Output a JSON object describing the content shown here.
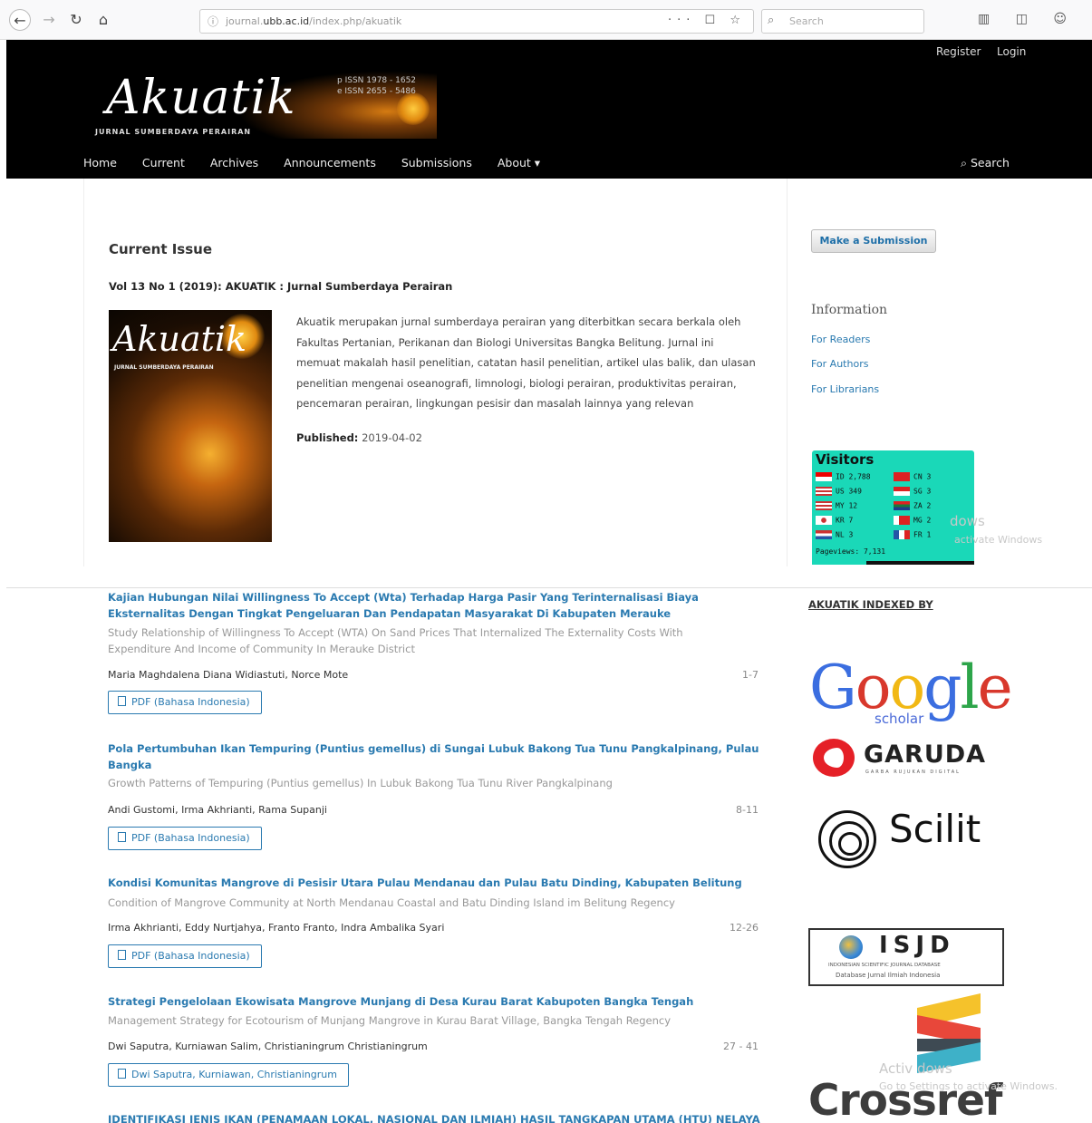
{
  "browser": {
    "back_icon": "back-arrow-icon",
    "url_prefix": "journal.",
    "url_domain": "ubb.ac.id",
    "url_path": "/index.php/akuatik",
    "url_actions": "··· ☐ ☆",
    "search_placeholder": "Search",
    "toolbar_icons": "▥ ◫ ☺"
  },
  "header": {
    "register_label": "Register",
    "login_label": "Login",
    "logo_text": "Akuatik",
    "logo_subtitle": "JURNAL SUMBERDAYA PERAIRAN",
    "issn_print": "p ISSN 1978 - 1652",
    "issn_electronic": "e ISSN 2655 - 5486",
    "nav": [
      "Home",
      "Current",
      "Archives",
      "Announcements",
      "Submissions",
      "About ▾"
    ],
    "search_label": "Search"
  },
  "main": {
    "heading": "Current Issue",
    "issue_identification": "Vol 13 No 1 (2019): AKUATIK : Jurnal Sumberdaya Perairan",
    "cover_title": "Akuatik",
    "cover_subtitle": "JURNAL SUMBERDAYA PERAIRAN",
    "description": "Akuatik merupakan jurnal sumberdaya perairan yang diterbitkan secara berkala oleh Fakultas Pertanian, Perikanan dan Biologi Universitas Bangka Belitung. Jurnal ini memuat makalah hasil penelitian, catatan hasil penelitian, artikel ulas balik, dan ulasan penelitian mengenai oseanografi, limnologi, biologi perairan, produktivitas perairan, pencemaran perairan, lingkungan pesisir dan masalah lainnya yang relevan",
    "published_label": "Published:",
    "published_date": "2019-04-02"
  },
  "sidebar": {
    "submit_label": "Make a Submission",
    "info_title": "Information",
    "info_links": [
      "For Readers",
      "For Authors",
      "For Librarians"
    ],
    "visitors": {
      "title": "Visitors",
      "left_column": [
        "ID 2,788",
        "US 349",
        "MY 12",
        "KR 7",
        "NL 3"
      ],
      "right_column": [
        "CN 3",
        "SG 3",
        "ZA 2",
        "MG 2",
        "FR 1"
      ],
      "pageviews": "Pageviews: 7,131"
    },
    "indexed_title": "AKUATIK INDEXED BY",
    "google_word": "Google",
    "google_scholar": "scholar",
    "garuda_word": "GARUDA",
    "garuda_tagline": "GARBA RUJUKAN DIGITAL",
    "scilit_word": "Scilit",
    "isjd_word": "ISJD",
    "isjd_line1": "INDONESIAN SCIENTIFIC JOURNAL DATABASE",
    "isjd_line2": "Database Jurnal Ilmiah Indonesia",
    "crossref_word": "Crossref"
  },
  "watermarks": {
    "top_large": "dows",
    "top_small": "activate Windows",
    "bottom_large": "Activ         dows",
    "bottom_small": "Go to Settings to activate Windows."
  },
  "articles": [
    {
      "title": "Kajian Hubungan Nilai Willingness To Accept (Wta) Terhadap Harga Pasir Yang Terinternalisasi Biaya Eksternalitas Dengan Tingkat Pengeluaran Dan Pendapatan Masyarakat Di Kabupaten Merauke",
      "subtitle": "Study Relationship of Willingness To Accept (WTA) On Sand Prices That Internalized The Externality Costs With Expenditure And Income of Community In Merauke District",
      "authors": "Maria Maghdalena Diana Widiastuti, Norce Mote",
      "pages": "1-7",
      "galley": "PDF (Bahasa Indonesia)"
    },
    {
      "title": "Pola Pertumbuhan Ikan Tempuring (Puntius gemellus) di Sungai Lubuk Bakong Tua Tunu Pangkalpinang, Pulau Bangka",
      "subtitle": "Growth Patterns of Tempuring (Puntius gemellus) In Lubuk Bakong Tua Tunu River Pangkalpinang",
      "authors": "Andi Gustomi, Irma Akhrianti, Rama Supanji",
      "pages": "8-11",
      "galley": "PDF (Bahasa Indonesia)"
    },
    {
      "title": "Kondisi Komunitas Mangrove di Pesisir Utara Pulau Mendanau dan Pulau Batu Dinding, Kabupaten Belitung",
      "subtitle": "Condition of Mangrove Community at North Mendanau Coastal and Batu Dinding Island im Belitung Regency",
      "authors": "Irma Akhrianti, Eddy Nurtjahya, Franto Franto, Indra Ambalika Syari",
      "pages": "12-26",
      "galley": "PDF (Bahasa Indonesia)"
    },
    {
      "title": "Strategi Pengelolaan Ekowisata Mangrove Munjang di Desa Kurau Barat Kabupoten Bangka Tengah",
      "subtitle": "Management Strategy for Ecotourism of Munjang Mangrove in Kurau Barat Village, Bangka Tengah Regency",
      "authors": "Dwi Saputra, Kurniawan Salim, Christianingrum Christianingrum",
      "pages": "27 - 41",
      "galley": "Dwi Saputra, Kurniawan, Christianingrum"
    },
    {
      "title": "IDENTIFIKASI JENIS IKAN (PENAMAAN LOKAL, NASIONAL DAN ILMIAH) HASIL TANGKAPAN UTAMA (HTU) NELAYAN"
    }
  ],
  "colors": {
    "link_blue": "#2a7ab0",
    "header_black": "#000000",
    "visitors_teal": "#1ad8b8"
  }
}
